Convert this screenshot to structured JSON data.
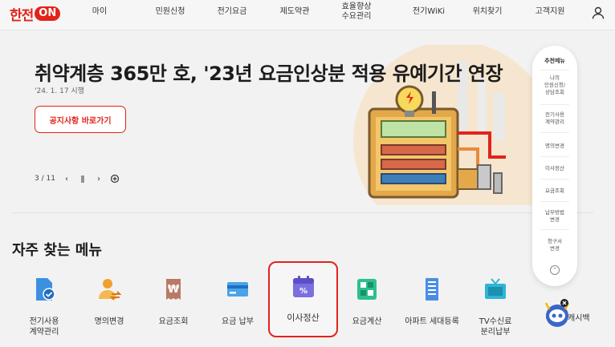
{
  "header": {
    "logo_text": "한전",
    "logo_on": "ON",
    "nav": [
      {
        "label": "마이"
      },
      {
        "label": "민원신청"
      },
      {
        "label": "전기요금"
      },
      {
        "label": "제도약관"
      },
      {
        "label": "효율향상\n수요관리"
      },
      {
        "label": "전기WiKi"
      },
      {
        "label": "위치찾기"
      },
      {
        "label": "고객지원"
      }
    ],
    "user_icon": "user-icon"
  },
  "hero": {
    "title": "취약계층 365만 호, '23년 요금인상분 적용 유예기간 연장",
    "date": "'24. 1. 17 시행",
    "button_label": "공지사항 바로가기",
    "pager_current": "3",
    "pager_sep": "/",
    "pager_total": "11"
  },
  "section_title": "자주 찾는 메뉴",
  "menus": [
    {
      "label": "전기사용\n계약관리",
      "icon": "document-check-icon",
      "color": "#3d8fe0"
    },
    {
      "label": "명의변경",
      "icon": "person-transfer-icon",
      "color": "#f0a030"
    },
    {
      "label": "요금조회",
      "icon": "won-receipt-icon",
      "color": "#b87a66"
    },
    {
      "label": "요금 납부",
      "icon": "card-icon",
      "color": "#4aa3e8"
    },
    {
      "label": "이사정산",
      "icon": "calendar-percent-icon",
      "color": "#7b6fe0"
    },
    {
      "label": "요금계산",
      "icon": "calculator-icon",
      "color": "#2dbf8f"
    },
    {
      "label": "아파트 세대등록",
      "icon": "building-icon",
      "color": "#4a8de8"
    },
    {
      "label": "TV수신료\n분리납부",
      "icon": "tv-icon",
      "color": "#2eb5d6"
    },
    {
      "label": "에너지캐시백",
      "icon": "chatbot-icon",
      "color": "#3a66c9"
    }
  ],
  "recommend": {
    "title": "추천메뉴",
    "items": [
      {
        "label": "나의\n민원신청/\n상담조회"
      },
      {
        "label": "전기사용\n계약관리"
      },
      {
        "label": "명의변경"
      },
      {
        "label": "이사정산"
      },
      {
        "label": "요금조회"
      },
      {
        "label": "납부방법\n변경"
      },
      {
        "label": "청구서\n변경"
      }
    ]
  },
  "colors": {
    "brand": "#e2231a",
    "background": "#f2f2f2"
  }
}
